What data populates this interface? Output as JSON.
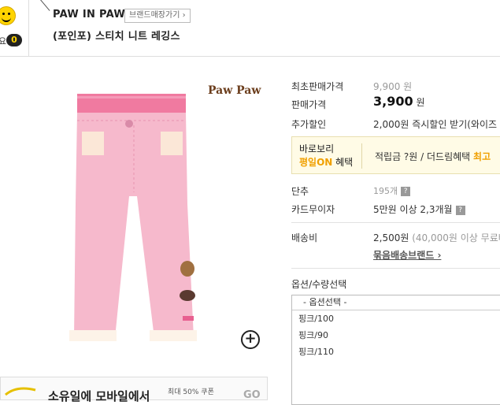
{
  "header": {
    "like_label": "요",
    "like_count": "0",
    "brand": "PAW IN PAW",
    "brand_shop_btn": "브랜드매장가기 ›",
    "product_title": "(포인포) 스티치 니트 레깅스"
  },
  "image": {
    "logo_text": "Paw Paw",
    "zoom_icon": "+"
  },
  "banner": {
    "text_part1": "소유일",
    "text_part2": "에 ",
    "text_part3": "모바일",
    "text_part4": "에서",
    "small_text": "최대 50% 쿠폰",
    "go": "GO"
  },
  "info": {
    "min_price_label": "최초판매가격",
    "min_price_value": "9,900 원",
    "sale_price_label": "판매가격",
    "sale_price_value": "3,900",
    "sale_price_unit": "원",
    "extra_discount_label": "추가할인",
    "extra_discount_value": "2,000원 즉시할인 받기(와이즈",
    "benefit_line1": "바로보리",
    "benefit_line2_hl": "평일ON",
    "benefit_line2": " 혜택",
    "benefit_desc": "적립금 ?원 / 더드림혜택 ",
    "benefit_desc_hl": "최고",
    "unit_label": "단추",
    "unit_value": "195개",
    "card_label": "카드무이자",
    "card_value": "5만원 이상 2,3개월",
    "shipping_label": "배송비",
    "shipping_value": "2,500원",
    "shipping_condition": "(40,000원 이상 무료배",
    "bundle_link": "묶음배송브랜드 ›"
  },
  "options": {
    "title": "옵션/수량선택",
    "placeholder": "- 옵션선택 -",
    "items": [
      "핑크/100",
      "핑크/90",
      "핑크/110"
    ]
  },
  "colors": {
    "pants_pink": "#f6b9cc",
    "waistband": "#f07aa0",
    "accent_orange": "#f0a000"
  }
}
